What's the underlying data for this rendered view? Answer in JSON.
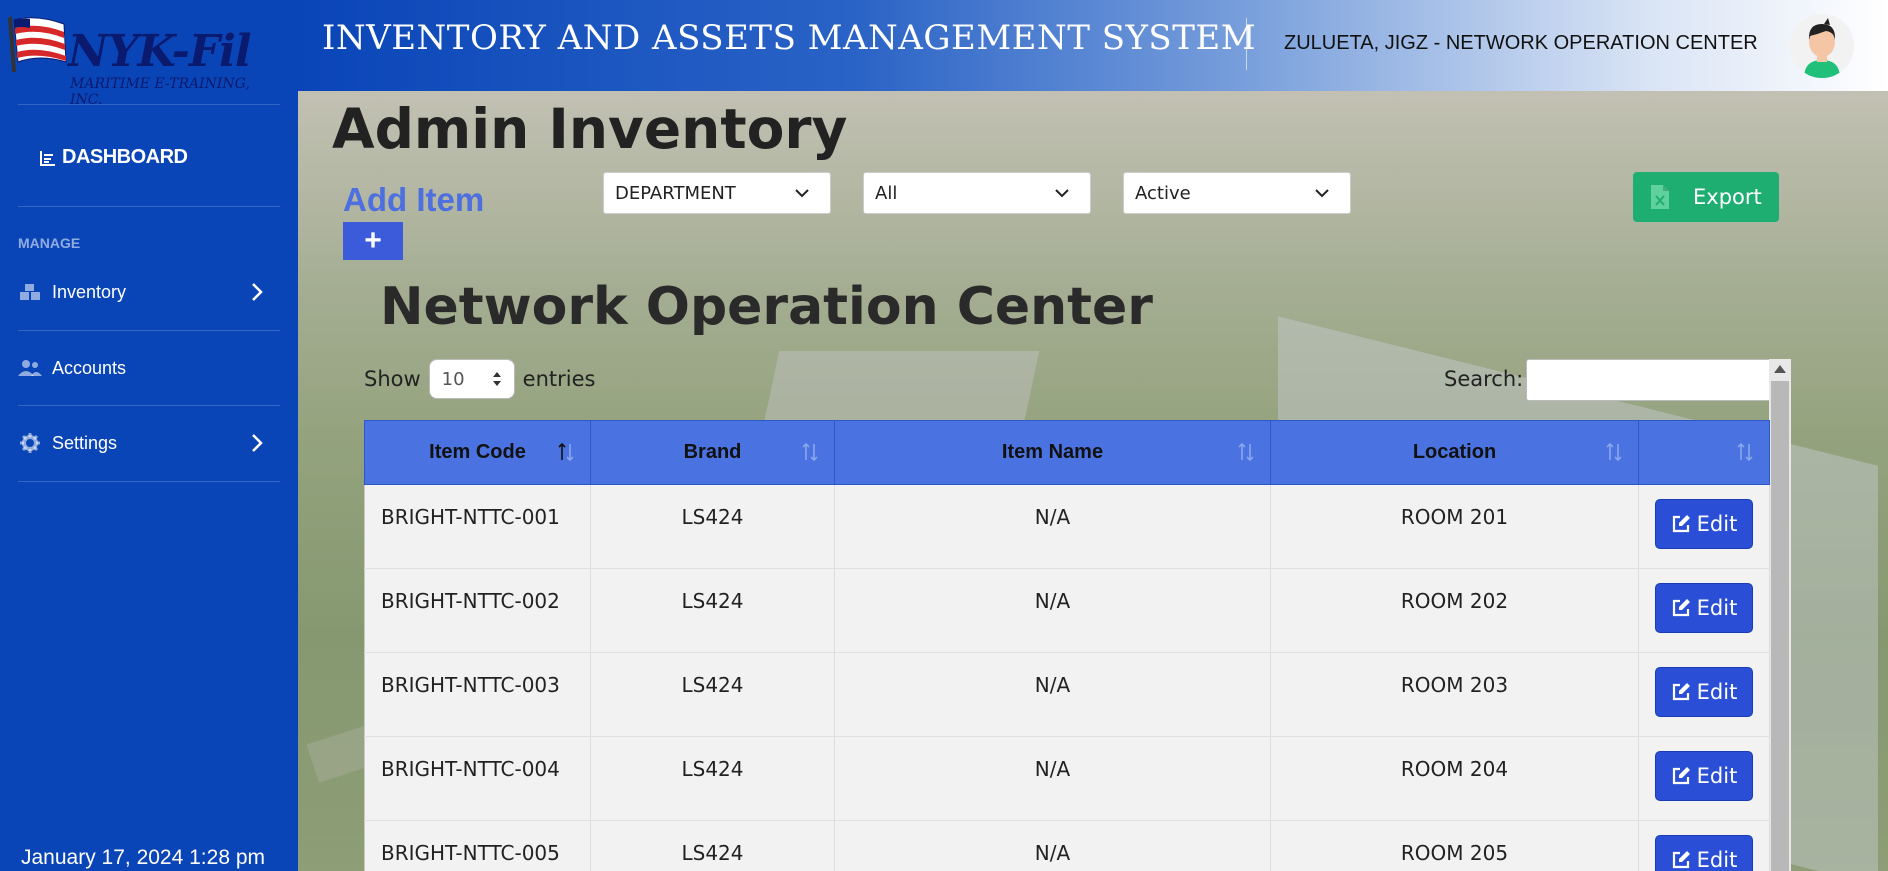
{
  "sidebar": {
    "logo_text": "NYK-Fil",
    "logo_tagline": "MARITIME E-TRAINING, INC.",
    "dashboard_label": "DASHBOARD",
    "manage_label": "MANAGE",
    "items": [
      {
        "label": "Inventory",
        "icon": "boxes-icon",
        "has_chevron": true
      },
      {
        "label": "Accounts",
        "icon": "users-icon",
        "has_chevron": false
      },
      {
        "label": "Settings",
        "icon": "gear-icon",
        "has_chevron": true
      }
    ],
    "datetime": "January 17, 2024 1:28 pm"
  },
  "header": {
    "title": "INVENTORY AND ASSETS MANAGEMENT SYSTEM",
    "user": "ZULUETA, JIGZ - NETWORK OPERATION CENTER"
  },
  "main": {
    "page_title": "Admin Inventory",
    "add_item_label": "Add Item",
    "add_button_label": "+",
    "filters": [
      {
        "value": "DEPARTMENT"
      },
      {
        "value": "All"
      },
      {
        "value": "Active"
      }
    ],
    "export_label": "Export",
    "section_title": "Network Operation Center",
    "show_label": "Show",
    "entries_value": "10",
    "entries_label": "entries",
    "search_label": "Search:",
    "search_value": ""
  },
  "table": {
    "columns": [
      "Item Code",
      "Brand",
      "Item Name",
      "Location",
      ""
    ],
    "edit_label": "Edit",
    "rows": [
      {
        "code": "BRIGHT-NTTC-001",
        "brand": "LS424",
        "name": "N/A",
        "location": "ROOM 201"
      },
      {
        "code": "BRIGHT-NTTC-002",
        "brand": "LS424",
        "name": "N/A",
        "location": "ROOM 202"
      },
      {
        "code": "BRIGHT-NTTC-003",
        "brand": "LS424",
        "name": "N/A",
        "location": "ROOM 203"
      },
      {
        "code": "BRIGHT-NTTC-004",
        "brand": "LS424",
        "name": "N/A",
        "location": "ROOM 204"
      },
      {
        "code": "BRIGHT-NTTC-005",
        "brand": "LS424",
        "name": "N/A",
        "location": "ROOM 205"
      }
    ]
  },
  "colors": {
    "sidebar": "#0a45b8",
    "table_header": "#4a72e0",
    "edit_button": "#2a4fd6",
    "export_button": "#1fae72",
    "add_item": "#4d6fe0"
  }
}
